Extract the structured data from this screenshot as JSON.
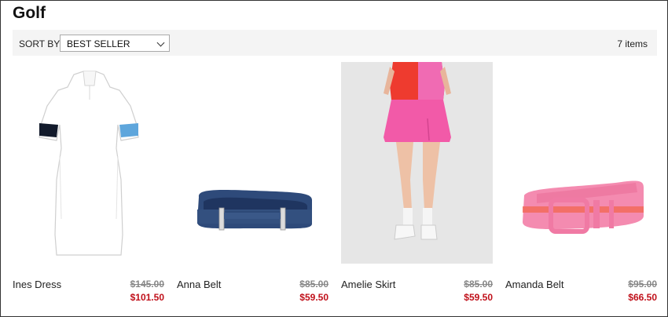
{
  "page": {
    "title": "Golf"
  },
  "toolbar": {
    "sort_label": "SORT BY:",
    "sort_value": "BEST SELLER",
    "item_count": "7 items"
  },
  "products": [
    {
      "name": "Ines Dress",
      "original_price": "$145.00",
      "sale_price": "$101.50"
    },
    {
      "name": "Anna Belt",
      "original_price": "$85.00",
      "sale_price": "$59.50"
    },
    {
      "name": "Amelie Skirt",
      "original_price": "$85.00",
      "sale_price": "$59.50"
    },
    {
      "name": "Amanda Belt",
      "original_price": "$95.00",
      "sale_price": "$66.50"
    }
  ],
  "colors": {
    "sale_price": "#c0101a",
    "toolbar_bg": "#f4f4f4"
  }
}
